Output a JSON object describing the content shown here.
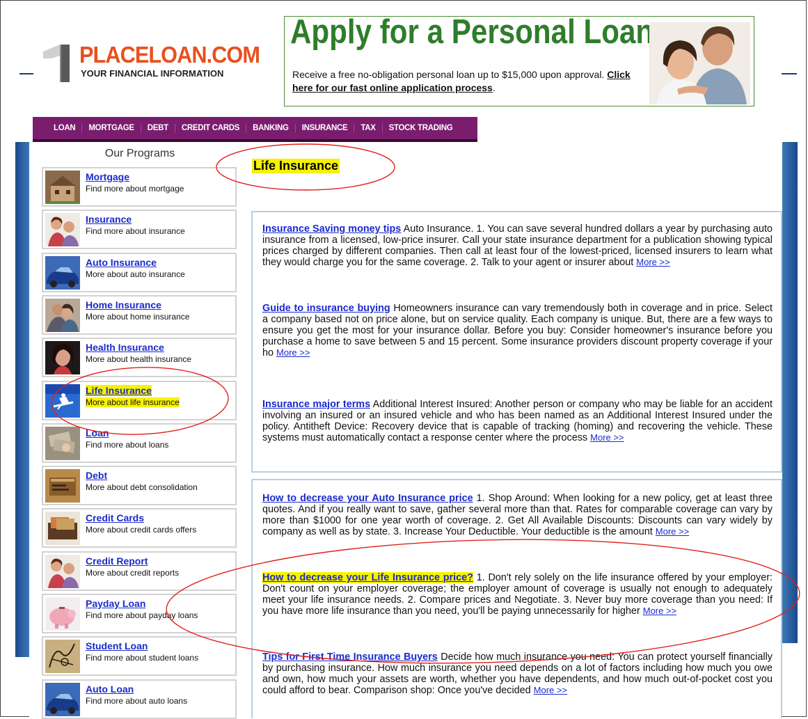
{
  "logo": {
    "name": "PLACELOAN.COM",
    "tagline": "YOUR FINANCIAL INFORMATION"
  },
  "banner": {
    "title": "Apply for a Personal Loan",
    "text": "Receive a free no-obligation personal loan up to $15,000 upon approval.",
    "link": "Click here for our fast online application process",
    "link_suffix": "."
  },
  "nav": [
    "LOAN",
    "MORTGAGE",
    "DEBT",
    "CREDIT CARDS",
    "BANKING",
    "INSURANCE",
    "TAX",
    "STOCK TRADING"
  ],
  "sidebar": {
    "title": "Our Programs",
    "items": [
      {
        "label": "Mortgage",
        "desc": "Find more about mortgage",
        "icon": "house-photo"
      },
      {
        "label": "Insurance",
        "desc": "Find more about insurance",
        "icon": "family-photo"
      },
      {
        "label": "Auto Insurance",
        "desc": "More about auto insurance",
        "icon": "car-photo"
      },
      {
        "label": "Home Insurance",
        "desc": "More about home insurance",
        "icon": "couple-photo"
      },
      {
        "label": "Health Insurance",
        "desc": "More about health insurance",
        "icon": "woman-photo"
      },
      {
        "label": "Life Insurance",
        "desc": "More about life insurance",
        "icon": "snowboarder-photo",
        "highlighted": true
      },
      {
        "label": "Loan",
        "desc": "Find more about loans",
        "icon": "money-photo"
      },
      {
        "label": "Debt",
        "desc": "More about debt consolidation",
        "icon": "wallet-photo"
      },
      {
        "label": "Credit Cards",
        "desc": "More about credit cards offers",
        "icon": "wallet-cards-photo"
      },
      {
        "label": "Credit Report",
        "desc": "More about credit reports",
        "icon": "family-photo"
      },
      {
        "label": "Payday Loan",
        "desc": "Find more about payday loans",
        "icon": "piggy-bank-photo"
      },
      {
        "label": "Student Loan",
        "desc": "Find more about student loans",
        "icon": "sketch-photo"
      },
      {
        "label": "Auto Loan",
        "desc": "Find more about auto loans",
        "icon": "car-photo"
      }
    ]
  },
  "main": {
    "title": "Life Insurance",
    "box1": [
      {
        "title": "Insurance Saving money tips",
        "body": " Auto Insurance. 1. You can save several hundred dollars a year by purchasing auto insurance from a licensed, low-price insurer. Call your state insurance department for a publication showing typical prices charged by different companies. Then call at least four of the lowest-priced, licensed insurers to learn what they would charge you for the same coverage. 2. Talk to your agent or insurer about ",
        "more": "More >>"
      },
      {
        "title": "Guide to insurance buying",
        "body": " Homeowners insurance can vary tremendously both in coverage and in price. Select a company based not on price alone, but on service quality. Each company is unique. But, there are a few ways to ensure you get the most for your insurance dollar. Before you buy: Consider homeowner's insurance before you purchase a home to save between 5 and 15 percent. Some insurance providers discount property coverage if your ho ",
        "more": "More >>"
      },
      {
        "title": "Insurance major terms",
        "body": " Additional Interest Insured: Another person or company who may be liable for an accident involving an insured or an insured vehicle and who has been named as an Additional Interest Insured under the policy. Antitheft Device: Recovery device that is capable of tracking (homing) and recovering the vehicle. These systems must automatically contact a response center where the process ",
        "more": "More >>"
      }
    ],
    "box2": [
      {
        "title": "How to decrease your Auto Insurance price",
        "body": " 1. Shop Around: When looking for a new policy, get at least three quotes. And if you really want to save, gather several more than that. Rates for comparable coverage can vary by more than $1000 for one year worth of coverage. 2. Get All Available Discounts: Discounts can vary widely by company as well as by state. 3. Increase Your Deductible. Your deductible is the amount ",
        "more": "More >>"
      },
      {
        "title": "How to decrease your Life Insurance price?",
        "body": " 1. Don't rely solely on the life insurance offered by your employer: Don't count on your employer coverage; the employer amount of coverage is usually not enough to adequately meet your life insurance needs. 2. Compare prices and Negotiate. 3. Never buy more coverage than you need: If you have more life insurance than you need, you'll be paying unnecessarily for higher ",
        "more": "More >>",
        "highlighted": true
      },
      {
        "title": "Tips for First Time Insurance Buyers",
        "body": " Decide how much insurance you need: You can protect yourself financially by purchasing insurance. How much insurance you need depends on a lot of factors including how much you owe and own, how much your assets are worth, whether you have dependents, and how much out-of-pocket cost you could afford to bear. Comparison shop: Once you've decided ",
        "more": "More >>"
      }
    ]
  },
  "colors": {
    "nav_bg": "#7a1d6e",
    "link": "#1a2acc",
    "highlight": "#f7f300",
    "annotation": "#e0201a",
    "banner_green": "#2e7d2b",
    "logo_orange": "#e8511e"
  }
}
